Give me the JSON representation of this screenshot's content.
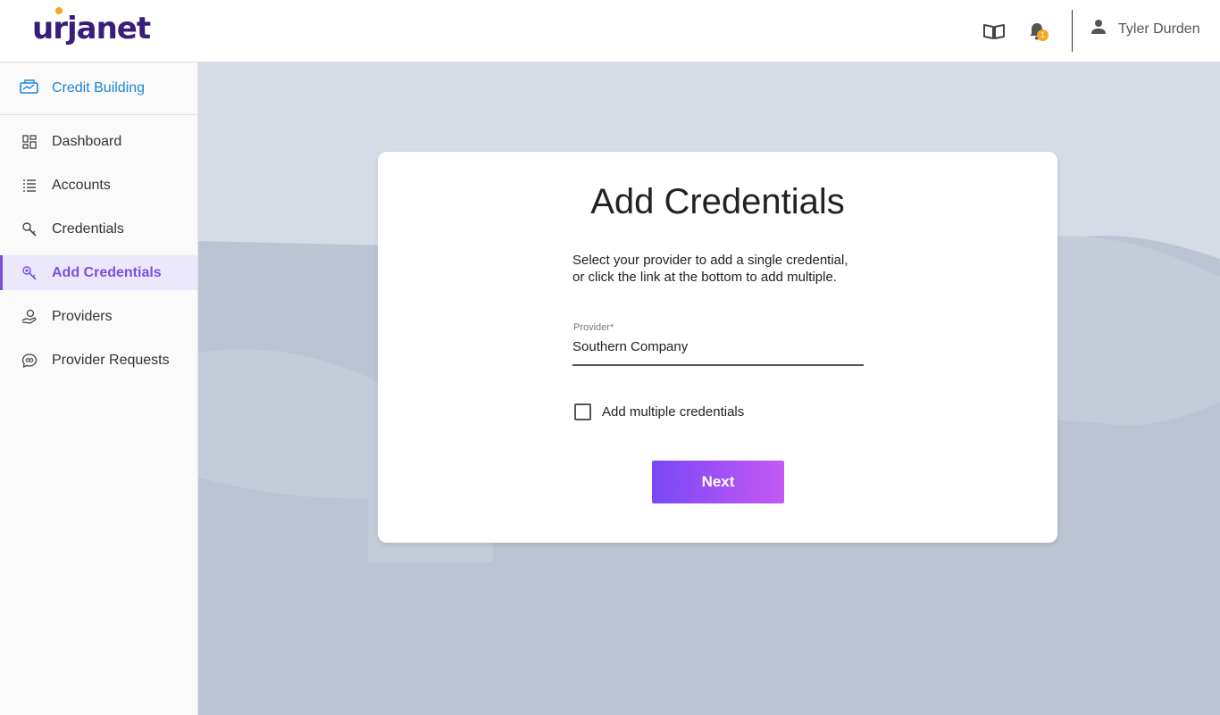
{
  "header": {
    "logo_text": "urjanet",
    "notification_count": "1",
    "user_name": "Tyler Durden",
    "icons": [
      "book-icon",
      "bell-icon",
      "user-icon"
    ]
  },
  "sidebar": {
    "product_label": "Credit Building",
    "items": [
      {
        "label": "Dashboard",
        "icon": "dashboard-icon",
        "active": false
      },
      {
        "label": "Accounts",
        "icon": "list-icon",
        "active": false
      },
      {
        "label": "Credentials",
        "icon": "key-icon",
        "active": false
      },
      {
        "label": "Add Credentials",
        "icon": "add-key-icon",
        "active": true
      },
      {
        "label": "Providers",
        "icon": "provider-icon",
        "active": false
      },
      {
        "label": "Provider Requests",
        "icon": "chat-icon",
        "active": false
      }
    ]
  },
  "card": {
    "title": "Add Credentials",
    "description_line1": "Select your provider to add a single credential,",
    "description_line2": "or click the link at the bottom to add multiple.",
    "provider_label": "Provider*",
    "provider_value": "Southern Company",
    "checkbox_label": "Add multiple credentials",
    "checkbox_checked": false,
    "next_label": "Next"
  },
  "colors": {
    "brand": "#3a1d7a",
    "accent": "#7b4fe0",
    "link": "#1a86d6",
    "badge": "#f5a623",
    "background": "#bcc4d3"
  }
}
